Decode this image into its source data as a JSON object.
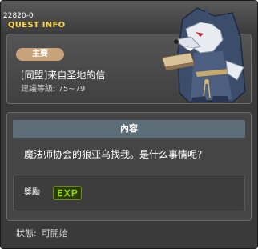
{
  "window": {
    "quest_id": "22820-0",
    "title": "QUEST INFO"
  },
  "quest": {
    "category": "主要",
    "name": "[同盟]来自圣地的信",
    "level_requirement": "建議等級:  75~79"
  },
  "content": {
    "header": "內容",
    "description": "魔法师协会的狼亚乌找我。是什么事情呢?"
  },
  "reward": {
    "label": "獎勵",
    "exp_text": "EXP"
  },
  "status": {
    "label": "狀態:",
    "value": "可開始"
  },
  "colors": {
    "title_accent": "#f7d54a",
    "badge": "#c8a27a",
    "content_header": "#5e6e78",
    "exp": "#9be000"
  },
  "icons": {
    "npc_portrait": "wolf-npc-icon",
    "exp_reward": "exp-icon"
  }
}
